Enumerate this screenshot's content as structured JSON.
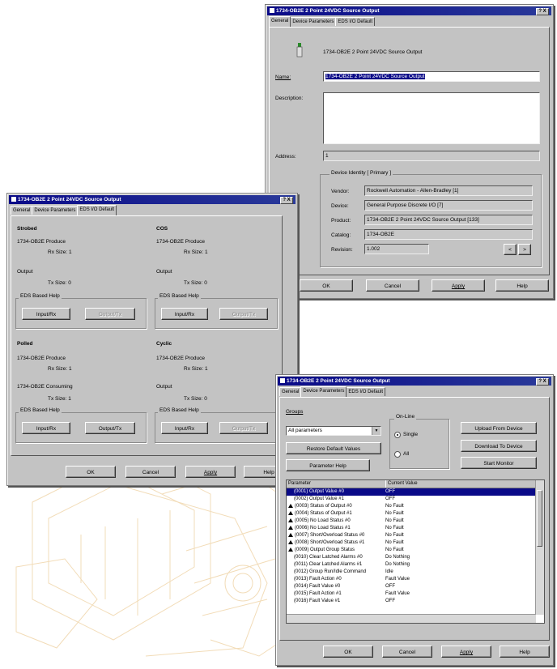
{
  "dialog_main": {
    "title": "1734-OB2E 2 Point 24VDC Source Output",
    "close": "? X",
    "tabs": [
      "General",
      "Device Parameters",
      "EDS I/O Default"
    ],
    "header_text": "1734-OB2E 2 Point 24VDC Source Output",
    "name_label": "Name:",
    "name_value": "1734-OB2E 2 Point 24VDC Source Output",
    "description_label": "Description:",
    "description_value": "",
    "address_label": "Address:",
    "address_value": "1",
    "identity_group": "Device Identity [ Primary ]",
    "identity": [
      {
        "label": "Vendor:",
        "value": "Rockwell Automation - Allen-Bradley [1]"
      },
      {
        "label": "Device:",
        "value": "General Purpose Discrete I/O [7]"
      },
      {
        "label": "Product:",
        "value": "1734-OB2E 2 Point 24VDC Source Output [133]"
      },
      {
        "label": "Catalog:",
        "value": "1734-OB2E"
      },
      {
        "label": "Revision:",
        "value": "1.002"
      }
    ],
    "buttons": {
      "ok": "OK",
      "cancel": "Cancel",
      "apply": "Apply",
      "help": "Help"
    },
    "spin": [
      "<",
      ">"
    ]
  },
  "dialog_eds": {
    "title": "1734-OB2E 2 Point 24VDC Source Output",
    "close": "? X",
    "tabs": [
      "General",
      "Device Parameters",
      "EDS I/O Default"
    ],
    "sections": [
      {
        "title": "Strobed",
        "l1": "1734-OB2E Produce",
        "l2": "Rx Size:   1",
        "l3": "Output",
        "l4": "Tx Size:   0",
        "eds": "EDS Based Help",
        "b1": "Input/Rx",
        "b2": "Output/Tx"
      },
      {
        "title": "COS",
        "l1": "1734-OB2E Produce",
        "l2": "Rx Size:   1",
        "l3": "Output",
        "l4": "Tx Size:   0",
        "eds": "EDS Based Help",
        "b1": "Input/Rx",
        "b2": "Output/Tx"
      },
      {
        "title": "Polled",
        "l1": "1734-OB2E Produce",
        "l2": "Rx Size:   1",
        "l3": "1734-OB2E Consuming",
        "l4": "Tx Size:   1",
        "eds": "EDS Based Help",
        "b1": "Input/Rx",
        "b2": "Output/Tx"
      },
      {
        "title": "Cyclic",
        "l1": "1734-OB2E Produce",
        "l2": "Rx Size:   1",
        "l3": "Output",
        "l4": "Tx Size:   0",
        "eds": "EDS Based Help",
        "b1": "Input/Rx",
        "b2": "Output/Tx"
      }
    ],
    "buttons": {
      "ok": "OK",
      "cancel": "Cancel",
      "apply": "Apply",
      "help": "Help"
    }
  },
  "dialog_params": {
    "title": "1734-OB2E 2 Point 24VDC Source Output",
    "close": "? X",
    "tabs": [
      "General",
      "Device Parameters",
      "EDS I/O Default"
    ],
    "groups_label": "Groups",
    "groups_value": "All parameters",
    "restore_btn": "Restore Default Values",
    "param_help_btn": "Parameter Help",
    "online_label": "On-Line",
    "single_label": "Single",
    "all_label": "All",
    "upload_btn": "Upload From Device",
    "download_btn": "Download To Device",
    "startmonitor_btn": "Start Monitor",
    "col_param": "Parameter",
    "col_value": "Current Value",
    "rows": [
      {
        "icon": "none",
        "param": "(0001) Output Value #0",
        "value": "OFF"
      },
      {
        "icon": "none",
        "param": "(0002) Output Value #1",
        "value": "OFF"
      },
      {
        "icon": "warn",
        "param": "(0003) Status of Output #0",
        "value": "No Fault"
      },
      {
        "icon": "warn",
        "param": "(0004) Status of Output #1",
        "value": "No Fault"
      },
      {
        "icon": "warn",
        "param": "(0005) No Load Status #0",
        "value": "No Fault"
      },
      {
        "icon": "warn",
        "param": "(0006) No Load Status #1",
        "value": "No Fault"
      },
      {
        "icon": "warn",
        "param": "(0007) Short/Overload Status #0",
        "value": "No Fault"
      },
      {
        "icon": "warn",
        "param": "(0008) Short/Overload Status #1",
        "value": "No Fault"
      },
      {
        "icon": "warn",
        "param": "(0009) Output Group Status",
        "value": "No Fault"
      },
      {
        "icon": "none",
        "param": "(0010) Clear Latched Alarms #0",
        "value": "Do Nothing"
      },
      {
        "icon": "none",
        "param": "(0011) Clear Latched Alarms #1",
        "value": "Do Nothing"
      },
      {
        "icon": "none",
        "param": "(0012) Group Run/Idle Command",
        "value": "Idle"
      },
      {
        "icon": "none",
        "param": "(0013) Fault Action #0",
        "value": "Fault Value"
      },
      {
        "icon": "none",
        "param": "(0014) Fault Value #0",
        "value": "OFF"
      },
      {
        "icon": "none",
        "param": "(0015) Fault Action #1",
        "value": "Fault Value"
      },
      {
        "icon": "none",
        "param": "(0016) Fault Value #1",
        "value": "OFF"
      }
    ],
    "buttons": {
      "ok": "OK",
      "cancel": "Cancel",
      "apply": "Apply",
      "help": "Help"
    }
  }
}
